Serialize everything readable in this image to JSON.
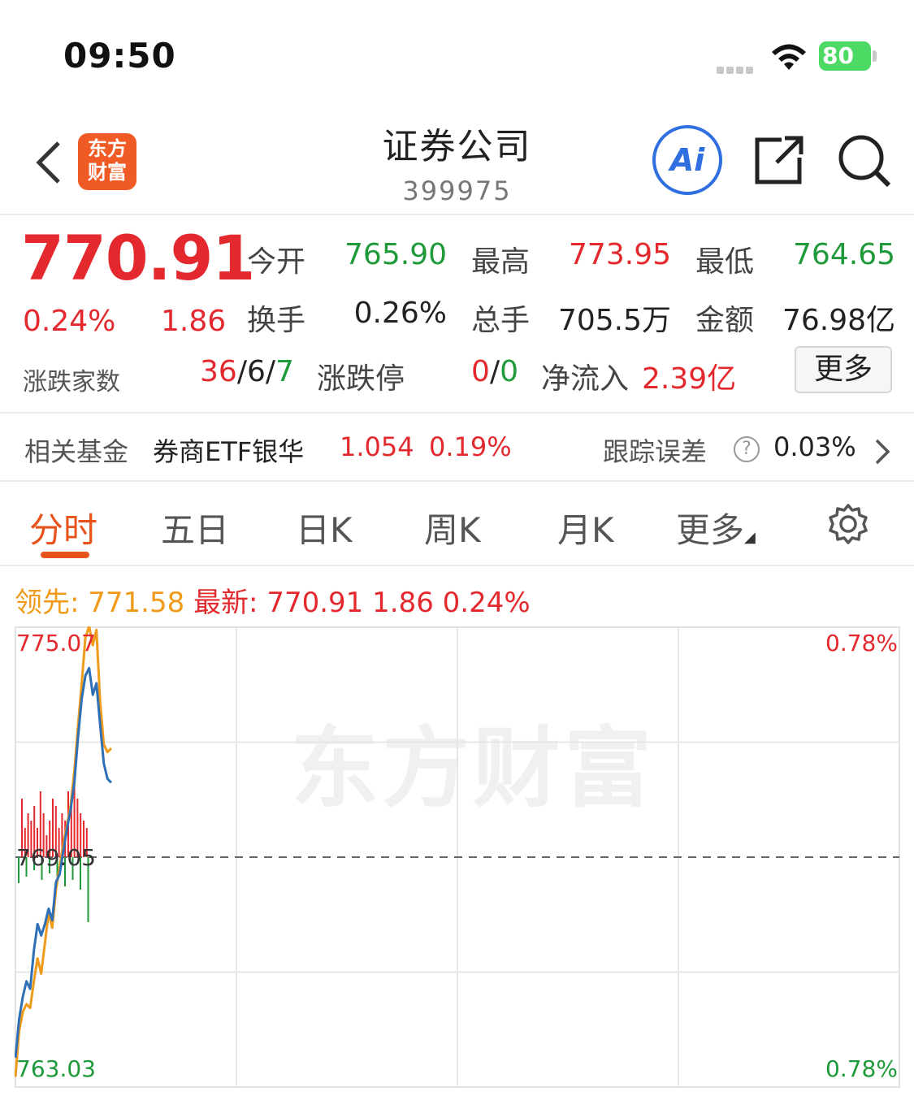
{
  "status_bar": {
    "time": "09:50",
    "battery": "80"
  },
  "nav": {
    "brand_logo_line1": "东方",
    "brand_logo_line2": "财富",
    "title": "证券公司",
    "code": "399975",
    "ai_label": "Ai"
  },
  "quote": {
    "price": "770.91",
    "change_pct": "0.24%",
    "change": "1.86",
    "stats": [
      {
        "label": "今开",
        "value": "765.90",
        "tone": "green"
      },
      {
        "label": "最高",
        "value": "773.95",
        "tone": "red"
      },
      {
        "label": "最低",
        "value": "764.65",
        "tone": "green"
      },
      {
        "label": "换手",
        "value": "0.26%",
        "tone": "dark"
      },
      {
        "label": "总手",
        "value": "705.5万",
        "tone": "dark"
      },
      {
        "label": "金额",
        "value": "76.98亿",
        "tone": "dark"
      }
    ],
    "breadth_label": "涨跌家数",
    "breadth_up": "36",
    "breadth_flat": "6",
    "breadth_down": "7",
    "limit_label": "涨跌停",
    "limit_up": "0",
    "limit_down": "0",
    "inflow_label": "净流入",
    "inflow_value": "2.39亿",
    "more_label": "更多"
  },
  "fund": {
    "label": "相关基金",
    "name": "券商ETF银华",
    "price": "1.054",
    "change": "0.19%",
    "tracking_label": "跟踪误差",
    "tracking_value": "0.03%"
  },
  "tabs": [
    {
      "label": "分时",
      "active": true
    },
    {
      "label": "五日",
      "active": false
    },
    {
      "label": "日K",
      "active": false
    },
    {
      "label": "周K",
      "active": false
    },
    {
      "label": "月K",
      "active": false
    },
    {
      "label": "更多",
      "active": false
    }
  ],
  "legend": {
    "lead_label": "领先:",
    "lead_value": "771.58",
    "latest_label": "最新:",
    "latest_value": "770.91",
    "latest_change": "1.86",
    "latest_pct": "0.24%"
  },
  "chart_data": {
    "type": "line",
    "y_max_label": "775.07",
    "y_mid_label": "769.05",
    "y_min_label": "763.03",
    "pct_max_label": "0.78%",
    "pct_min_label": "0.78%",
    "watermark": "东方财富",
    "ylim": [
      763.03,
      775.07
    ],
    "base": 769.05,
    "total_points": 240,
    "grid": true,
    "series": [
      {
        "color": "#f09a1a",
        "values": [
          763.3,
          764.5,
          765.0,
          765.2,
          765.1,
          765.8,
          766.4,
          766.0,
          766.8,
          767.6,
          767.2,
          768.2,
          768.8,
          769.4,
          769.9,
          770.4,
          771.3,
          772.5,
          773.6,
          774.8,
          775.1,
          774.6,
          775.0,
          773.1,
          772.0,
          771.8,
          771.9
        ]
      },
      {
        "color": "#2e6fb5",
        "values": [
          763.8,
          764.8,
          765.4,
          765.8,
          765.6,
          766.6,
          767.3,
          767.0,
          767.3,
          767.7,
          767.4,
          768.4,
          768.6,
          769.2,
          769.8,
          770.3,
          771.0,
          772.2,
          773.2,
          773.8,
          774.0,
          773.3,
          773.6,
          772.5,
          771.5,
          771.1,
          771.0
        ]
      }
    ],
    "volume": [
      {
        "color": "#e3282e",
        "values": [
          0.8,
          0.4,
          0.6,
          0.5,
          0.7,
          0.4,
          0.9,
          0.6,
          0.3,
          0.5,
          0.8,
          0.7,
          0.4,
          0.6,
          0.5,
          0.9,
          0.7,
          1.0,
          0.8,
          0.6,
          0.5,
          0.4
        ]
      },
      {
        "color": "#1f9a3a",
        "values": [
          0.4,
          0.3,
          0.2,
          0.35,
          0.25,
          0.3,
          0.45,
          0.35,
          0.5,
          1.0
        ]
      }
    ]
  }
}
